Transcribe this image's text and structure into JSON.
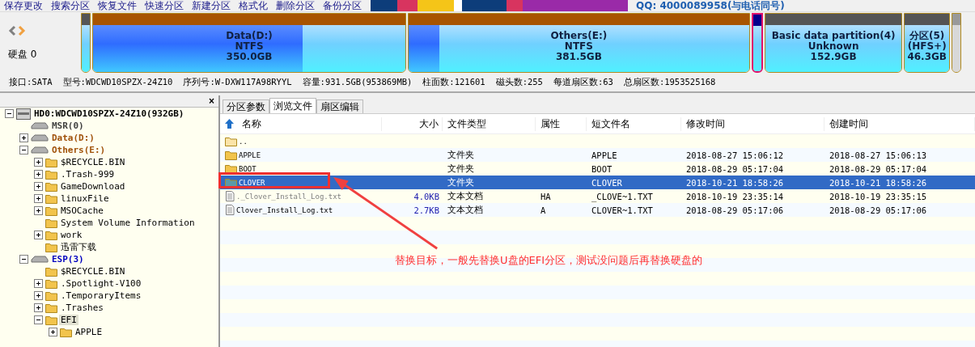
{
  "toolbar": {
    "buttons": [
      "保存更改",
      "搜索分区",
      "恢复文件",
      "快速分区",
      "新建分区",
      "格式化",
      "删除分区",
      "备份分区"
    ],
    "banner": {
      "tiles": [
        {
          "color": "#0d3d7a"
        },
        {
          "color": "#d8345f"
        },
        {
          "color": "#f5c518"
        },
        {
          "color": "#ffffff"
        },
        {
          "color": "#0d3d7a"
        },
        {
          "color": "#d8345f"
        },
        {
          "color": "#9a2aa8"
        }
      ],
      "contact": "QQ: 4000089958(与电话同号)"
    }
  },
  "disk": {
    "label": "硬盘 0",
    "partitions": [
      {
        "kind": "small",
        "color": "#555555",
        "selected": false
      },
      {
        "kind": "main",
        "color": "#a85400",
        "name": "Data(D:)",
        "fs": "NTFS",
        "size": "350.0GB",
        "level": 0.67,
        "selected": false
      },
      {
        "kind": "main",
        "color": "#a85400",
        "name": "Others(E:)",
        "fs": "NTFS",
        "size": "381.5GB",
        "level": 0.09,
        "selected": false
      },
      {
        "kind": "small",
        "color": "#00008b",
        "selected": true
      },
      {
        "kind": "main",
        "color": "#555555",
        "name": "Basic data partition(4)",
        "fs": "Unknown",
        "size": "152.9GB",
        "selected": false
      },
      {
        "kind": "main",
        "color": "#555555",
        "name": "分区(5)",
        "fs": "(HFS+)",
        "size": "46.3GB",
        "selected": false
      },
      {
        "kind": "free",
        "color": "#999999",
        "selected": false
      }
    ],
    "info": [
      "接口:SATA",
      "型号:WDCWD10SPZX-24Z10",
      "序列号:W-DXW117A98RYYL",
      "容量:931.5GB(953869MB)",
      "柱面数:121601",
      "磁头数:255",
      "每道扇区数:63",
      "总扇区数:1953525168"
    ]
  },
  "tree": {
    "close": "×",
    "items": [
      {
        "kind": "disk",
        "label": "HD0:WDCWD10SPZX-24Z10(932GB)",
        "expanded": true,
        "selected": false,
        "children": [
          {
            "kind": "partition",
            "label": "MSR(0)",
            "color": "#404040",
            "selected": false
          },
          {
            "kind": "partition",
            "label": "Data(D:)",
            "color": "#a0520a",
            "expanded": false,
            "selected": false
          },
          {
            "kind": "partition",
            "label": "Others(E:)",
            "color": "#a0520a",
            "expanded": true,
            "selected": false,
            "children": [
              {
                "kind": "folder",
                "label": "$RECYCLE.BIN",
                "expanded": false,
                "selected": false
              },
              {
                "kind": "folder",
                "label": ".Trash-999",
                "expanded": false,
                "selected": false
              },
              {
                "kind": "folder",
                "label": "GameDownload",
                "expanded": false,
                "selected": false
              },
              {
                "kind": "folder",
                "label": "linuxFile",
                "expanded": false,
                "selected": false
              },
              {
                "kind": "folder",
                "label": "MSOCache",
                "expanded": false,
                "selected": false
              },
              {
                "kind": "folder",
                "label": "System Volume Information",
                "selected": false
              },
              {
                "kind": "folder",
                "label": "work",
                "expanded": false,
                "selected": false
              },
              {
                "kind": "folder",
                "label": "迅雷下载",
                "selected": false
              }
            ]
          },
          {
            "kind": "partition",
            "label": "ESP(3)",
            "color": "#0000c0",
            "expanded": true,
            "selected": false,
            "children": [
              {
                "kind": "folder",
                "label": "$RECYCLE.BIN",
                "selected": false
              },
              {
                "kind": "folder",
                "label": ".Spotlight-V100",
                "expanded": false,
                "selected": false
              },
              {
                "kind": "folder",
                "label": ".TemporaryItems",
                "expanded": false,
                "selected": false
              },
              {
                "kind": "folder",
                "label": ".Trashes",
                "expanded": false,
                "selected": false
              },
              {
                "kind": "folder",
                "label": "EFI",
                "expanded": true,
                "selected": true,
                "children": [
                  {
                    "kind": "folder",
                    "label": "APPLE",
                    "expanded": false,
                    "selected": false
                  }
                ]
              }
            ]
          }
        ]
      }
    ]
  },
  "tabs": [
    {
      "label": "分区参数",
      "selected": false
    },
    {
      "label": "浏览文件",
      "selected": true
    },
    {
      "label": "扇区编辑",
      "selected": false
    }
  ],
  "columns": [
    "名称",
    "大小",
    "文件类型",
    "属性",
    "短文件名",
    "修改时间",
    "创建时间"
  ],
  "rows": [
    {
      "kind": "parent",
      "name": "..",
      "selected": false,
      "hidden": false
    },
    {
      "kind": "folder",
      "name": "APPLE",
      "type": "文件夹",
      "short": "APPLE",
      "modified": "2018-08-27 15:06:12",
      "created": "2018-08-27 15:06:13",
      "selected": false,
      "hidden": false
    },
    {
      "kind": "folder",
      "name": "BOOT",
      "type": "文件夹",
      "short": "BOOT",
      "modified": "2018-08-29 05:17:04",
      "created": "2018-08-29 05:17:04",
      "selected": false,
      "hidden": false
    },
    {
      "kind": "folder",
      "name": "CLOVER",
      "type": "文件夹",
      "short": "CLOVER",
      "modified": "2018-10-21 18:58:26",
      "created": "2018-10-21 18:58:26",
      "selected": true,
      "hidden": false
    },
    {
      "kind": "file",
      "name": "._Clover_Install_Log.txt",
      "size": "4.0KB",
      "type": "文本文档",
      "attr": "HA",
      "short": "_CLOVE~1.TXT",
      "modified": "2018-10-19 23:35:14",
      "created": "2018-10-19 23:35:15",
      "selected": false,
      "hidden": true
    },
    {
      "kind": "file",
      "name": "Clover_Install_Log.txt",
      "size": "2.7KB",
      "type": "文本文档",
      "attr": "A",
      "short": "CLOVER~1.TXT",
      "modified": "2018-08-29 05:17:06",
      "created": "2018-08-29 05:17:06",
      "selected": false,
      "hidden": false
    }
  ],
  "annotation": "替换目标，一般先替换U盘的EFI分区，测试没问题后再替换硬盘的"
}
